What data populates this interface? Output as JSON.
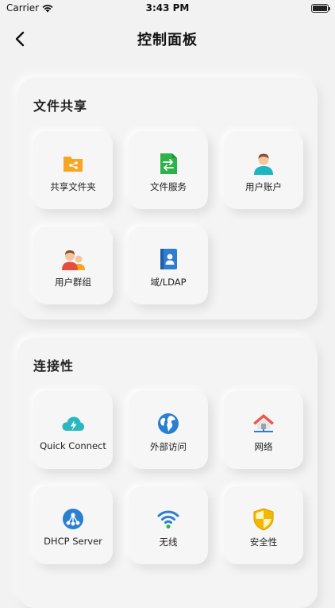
{
  "status_bar": {
    "carrier": "Carrier",
    "time": "3:43 PM"
  },
  "nav": {
    "title": "控制面板",
    "back_icon": "chevron-left-icon"
  },
  "sections": [
    {
      "title": "文件共享",
      "items": [
        {
          "label": "共享文件夹",
          "icon": "shared-folder-icon",
          "color": "#F5A623"
        },
        {
          "label": "文件服务",
          "icon": "file-service-icon",
          "color": "#2DB34A"
        },
        {
          "label": "用户账户",
          "icon": "user-account-icon",
          "color": "#1FB5C0"
        },
        {
          "label": "用户群组",
          "icon": "user-group-icon",
          "color": "#E84C3D"
        },
        {
          "label": "域/LDAP",
          "icon": "ldap-book-icon",
          "color": "#2F7DD1"
        }
      ]
    },
    {
      "title": "连接性",
      "items": [
        {
          "label": "Quick Connect",
          "icon": "cloud-lightning-icon",
          "color": "#2BB7C2"
        },
        {
          "label": "外部访问",
          "icon": "globe-icon",
          "color": "#2B7FD0"
        },
        {
          "label": "网络",
          "icon": "network-house-icon",
          "color": "#E85A4F"
        },
        {
          "label": "DHCP Server",
          "icon": "dhcp-network-icon",
          "color": "#2B7FD0"
        },
        {
          "label": "无线",
          "icon": "wifi-icon",
          "color": "#2B7FD0"
        },
        {
          "label": "安全性",
          "icon": "shield-icon",
          "color": "#F5B800"
        }
      ]
    }
  ]
}
